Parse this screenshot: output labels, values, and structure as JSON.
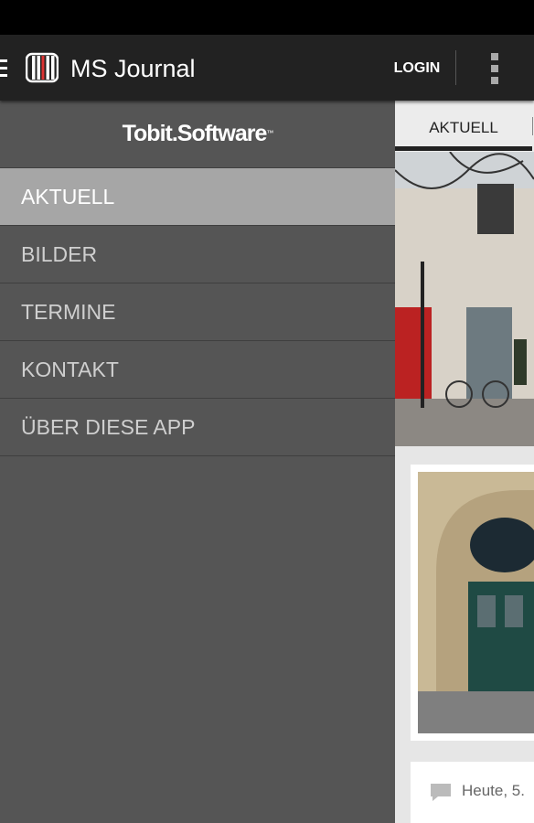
{
  "app": {
    "title": "MS Journal",
    "login_label": "LOGIN"
  },
  "drawer": {
    "brand": "Tobit.Software",
    "brand_tm": "™",
    "items": [
      {
        "label": "AKTUELL",
        "active": true
      },
      {
        "label": "BILDER"
      },
      {
        "label": "TERMINE"
      },
      {
        "label": "KONTAKT"
      },
      {
        "label": "ÜBER DIESE APP"
      }
    ]
  },
  "content": {
    "tab_label": "AKTUELL",
    "card_date": "Heute, 5."
  },
  "colors": {
    "actionbar": "#222222",
    "drawer": "#555555",
    "active_item": "#a6a6a6"
  },
  "icons": [
    "menu-icon",
    "app-logo-icon",
    "overflow-menu-icon",
    "comment-icon",
    "tobit-logo-icon"
  ]
}
